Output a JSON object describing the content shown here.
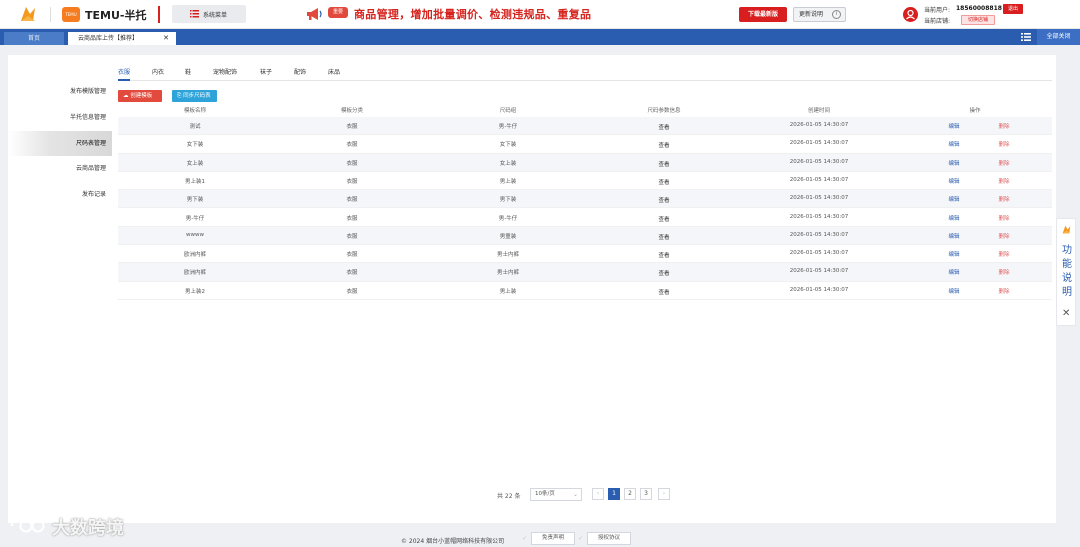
{
  "header": {
    "brand_badge": "TEMU",
    "brand_title": "TEMU-半托",
    "system_menu_label": "系统菜单",
    "notice_tag": "重要",
    "notice_text": "商品管理，增加批量调价、检测违规品、重复品",
    "download_label": "下载最新版",
    "update_label": "更新说明",
    "user_label": "当前用户:",
    "user_value": "18560008818",
    "logout_label": "退出",
    "store_label": "当前店铺:",
    "switch_store_label": "切换店铺"
  },
  "tabs": {
    "home": "首页",
    "active": "云商品库上传【推荐】",
    "close_all": "全部关闭"
  },
  "sidebar": {
    "items": [
      {
        "label": "发布模版管理"
      },
      {
        "label": "半托信息管理"
      },
      {
        "label": "尺码表管理"
      },
      {
        "label": "云商品管理"
      },
      {
        "label": "发布记录"
      }
    ],
    "active_index": 2
  },
  "category_tabs": [
    "衣服",
    "内衣",
    "鞋",
    "宠物配饰",
    "袜子",
    "配饰",
    "床品"
  ],
  "actions": {
    "create": "创建模板",
    "sync": "同步尺码表"
  },
  "table": {
    "columns": [
      "模板名称",
      "模板分类",
      "尺码组",
      "尺码参数信息",
      "创建时间",
      "操作"
    ],
    "rows": [
      {
        "name": "测试",
        "category": "衣服",
        "size_group": "男-牛仔",
        "params": "查看",
        "created": "2026-01-05 14:30:07",
        "edit": "编辑",
        "delete": "删除"
      },
      {
        "name": "女下装",
        "category": "衣服",
        "size_group": "女下装",
        "params": "查看",
        "created": "2026-01-05 14:30:07",
        "edit": "编辑",
        "delete": "删除"
      },
      {
        "name": "女上装",
        "category": "衣服",
        "size_group": "女上装",
        "params": "查看",
        "created": "2026-01-05 14:30:07",
        "edit": "编辑",
        "delete": "删除"
      },
      {
        "name": "男上装1",
        "category": "衣服",
        "size_group": "男上装",
        "params": "查看",
        "created": "2026-01-05 14:30:07",
        "edit": "编辑",
        "delete": "删除"
      },
      {
        "name": "男下装",
        "category": "衣服",
        "size_group": "男下装",
        "params": "查看",
        "created": "2026-01-05 14:30:07",
        "edit": "编辑",
        "delete": "删除"
      },
      {
        "name": "男-牛仔",
        "category": "衣服",
        "size_group": "男-牛仔",
        "params": "查看",
        "created": "2026-01-05 14:30:07",
        "edit": "编辑",
        "delete": "删除"
      },
      {
        "name": "wwww",
        "category": "衣服",
        "size_group": "男童装",
        "params": "查看",
        "created": "2026-01-05 14:30:07",
        "edit": "编辑",
        "delete": "删除"
      },
      {
        "name": "欧洲内裤",
        "category": "衣服",
        "size_group": "男士内裤",
        "params": "查看",
        "created": "2026-01-05 14:30:07",
        "edit": "编辑",
        "delete": "删除"
      },
      {
        "name": "欧洲内裤",
        "category": "衣服",
        "size_group": "男士内裤",
        "params": "查看",
        "created": "2026-01-05 14:30:07",
        "edit": "编辑",
        "delete": "删除"
      },
      {
        "name": "男上装2",
        "category": "衣服",
        "size_group": "男上装",
        "params": "查看",
        "created": "2026-01-05 14:30:07",
        "edit": "编辑",
        "delete": "删除"
      }
    ]
  },
  "pagination": {
    "total_label": "共 22 条",
    "page_size": "10条/页",
    "pages": [
      "1",
      "2",
      "3"
    ],
    "current": "1",
    "prev": "‹",
    "next": "›"
  },
  "side_widget": {
    "chars": [
      "功",
      "能",
      "说",
      "明"
    ],
    "close": "✕"
  },
  "footer": {
    "copyright": "© 2024 烟台小蓝帽网络科技有限公司",
    "disclaimer": "免责声明",
    "license": "授权协议"
  },
  "watermark": {
    "text": "大数跨境"
  },
  "colors": {
    "primary_blue": "#2a5db0",
    "accent_red": "#d81e1e",
    "orange": "#f57c1f",
    "sync_blue": "#2ea3d9"
  }
}
